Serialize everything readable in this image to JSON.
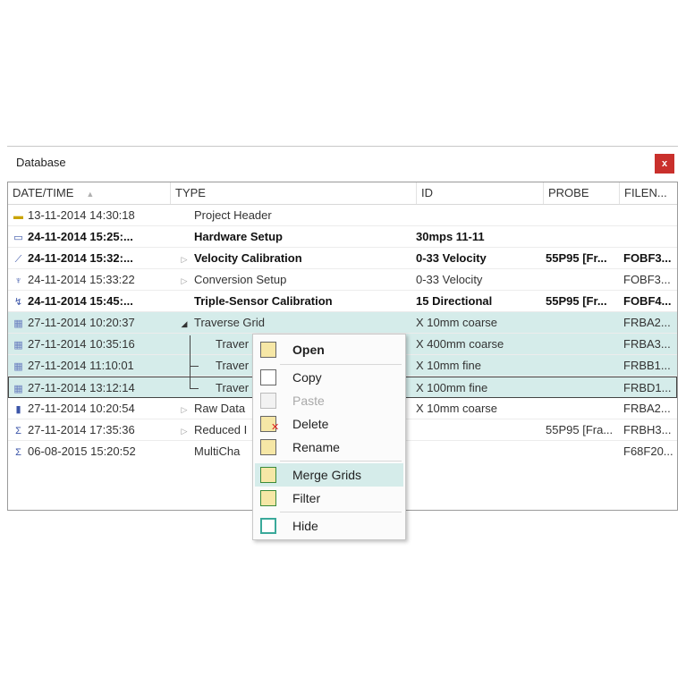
{
  "window": {
    "title": "Database",
    "close_label": "x"
  },
  "columns": [
    {
      "label": "DATE/TIME"
    },
    {
      "label": "TYPE"
    },
    {
      "label": "ID"
    },
    {
      "label": "PROBE"
    },
    {
      "label": "FILEN..."
    }
  ],
  "rows": [
    {
      "date": "13-11-2014 14:30:18",
      "type": "Project Header",
      "id": "",
      "probe": "",
      "file": "",
      "icon": "folder-icon"
    },
    {
      "date": "24-11-2014 15:25:...",
      "type": "Hardware Setup",
      "id": "30mps 11-11",
      "probe": "",
      "file": "",
      "icon": "hardware-icon"
    },
    {
      "date": "24-11-2014 15:32:...",
      "type": "Velocity Calibration",
      "id": "0-33 Velocity",
      "probe": "55P95 [Fr...",
      "file": "FOBF3...",
      "icon": "calibration-chart-icon"
    },
    {
      "date": "24-11-2014 15:33:22",
      "type": "Conversion Setup",
      "id": "0-33 Velocity",
      "probe": "",
      "file": "FOBF3...",
      "icon": "conversion-icon"
    },
    {
      "date": "24-11-2014 15:45:...",
      "type": "Triple-Sensor Calibration",
      "id": "15 Directional",
      "probe": "55P95 [Fr...",
      "file": "FOBF4...",
      "icon": "triple-sensor-icon"
    },
    {
      "date": "27-11-2014 10:20:37",
      "type": "Traverse Grid",
      "id": "X 10mm coarse",
      "probe": "",
      "file": "FRBA2...",
      "icon": "grid-icon"
    },
    {
      "date": "27-11-2014 10:35:16",
      "type": "Traver",
      "id": "X 400mm coarse",
      "probe": "",
      "file": "FRBA3...",
      "icon": "grid-icon"
    },
    {
      "date": "27-11-2014 11:10:01",
      "type": "Traver",
      "id": "X 10mm fine",
      "probe": "",
      "file": "FRBB1...",
      "icon": "grid-icon"
    },
    {
      "date": "27-11-2014 13:12:14",
      "type": "Traver",
      "id": "X 100mm fine",
      "probe": "",
      "file": "FRBD1...",
      "icon": "grid-icon"
    },
    {
      "date": "27-11-2014 10:20:54",
      "type": "Raw Data",
      "id": "X 10mm coarse",
      "probe": "",
      "file": "FRBA2...",
      "icon": "raw-data-icon"
    },
    {
      "date": "27-11-2014 17:35:36",
      "type": "Reduced I",
      "id": "",
      "probe": "55P95 [Fra...",
      "file": "FRBH3...",
      "icon": "sigma-icon"
    },
    {
      "date": "06-08-2015 15:20:52",
      "type": "MultiCha",
      "id": "",
      "probe": "",
      "file": "F68F20...",
      "icon": "sigma-multi-icon"
    }
  ],
  "menu": {
    "items": [
      {
        "label": "Open"
      },
      {
        "label": "Copy"
      },
      {
        "label": "Paste"
      },
      {
        "label": "Delete"
      },
      {
        "label": "Rename"
      },
      {
        "label": "Merge Grids"
      },
      {
        "label": "Filter"
      },
      {
        "label": "Hide"
      }
    ]
  },
  "colors": {
    "selection": "#d5ecea",
    "close": "#c9302c",
    "icon_blue": "#3b55a8"
  }
}
